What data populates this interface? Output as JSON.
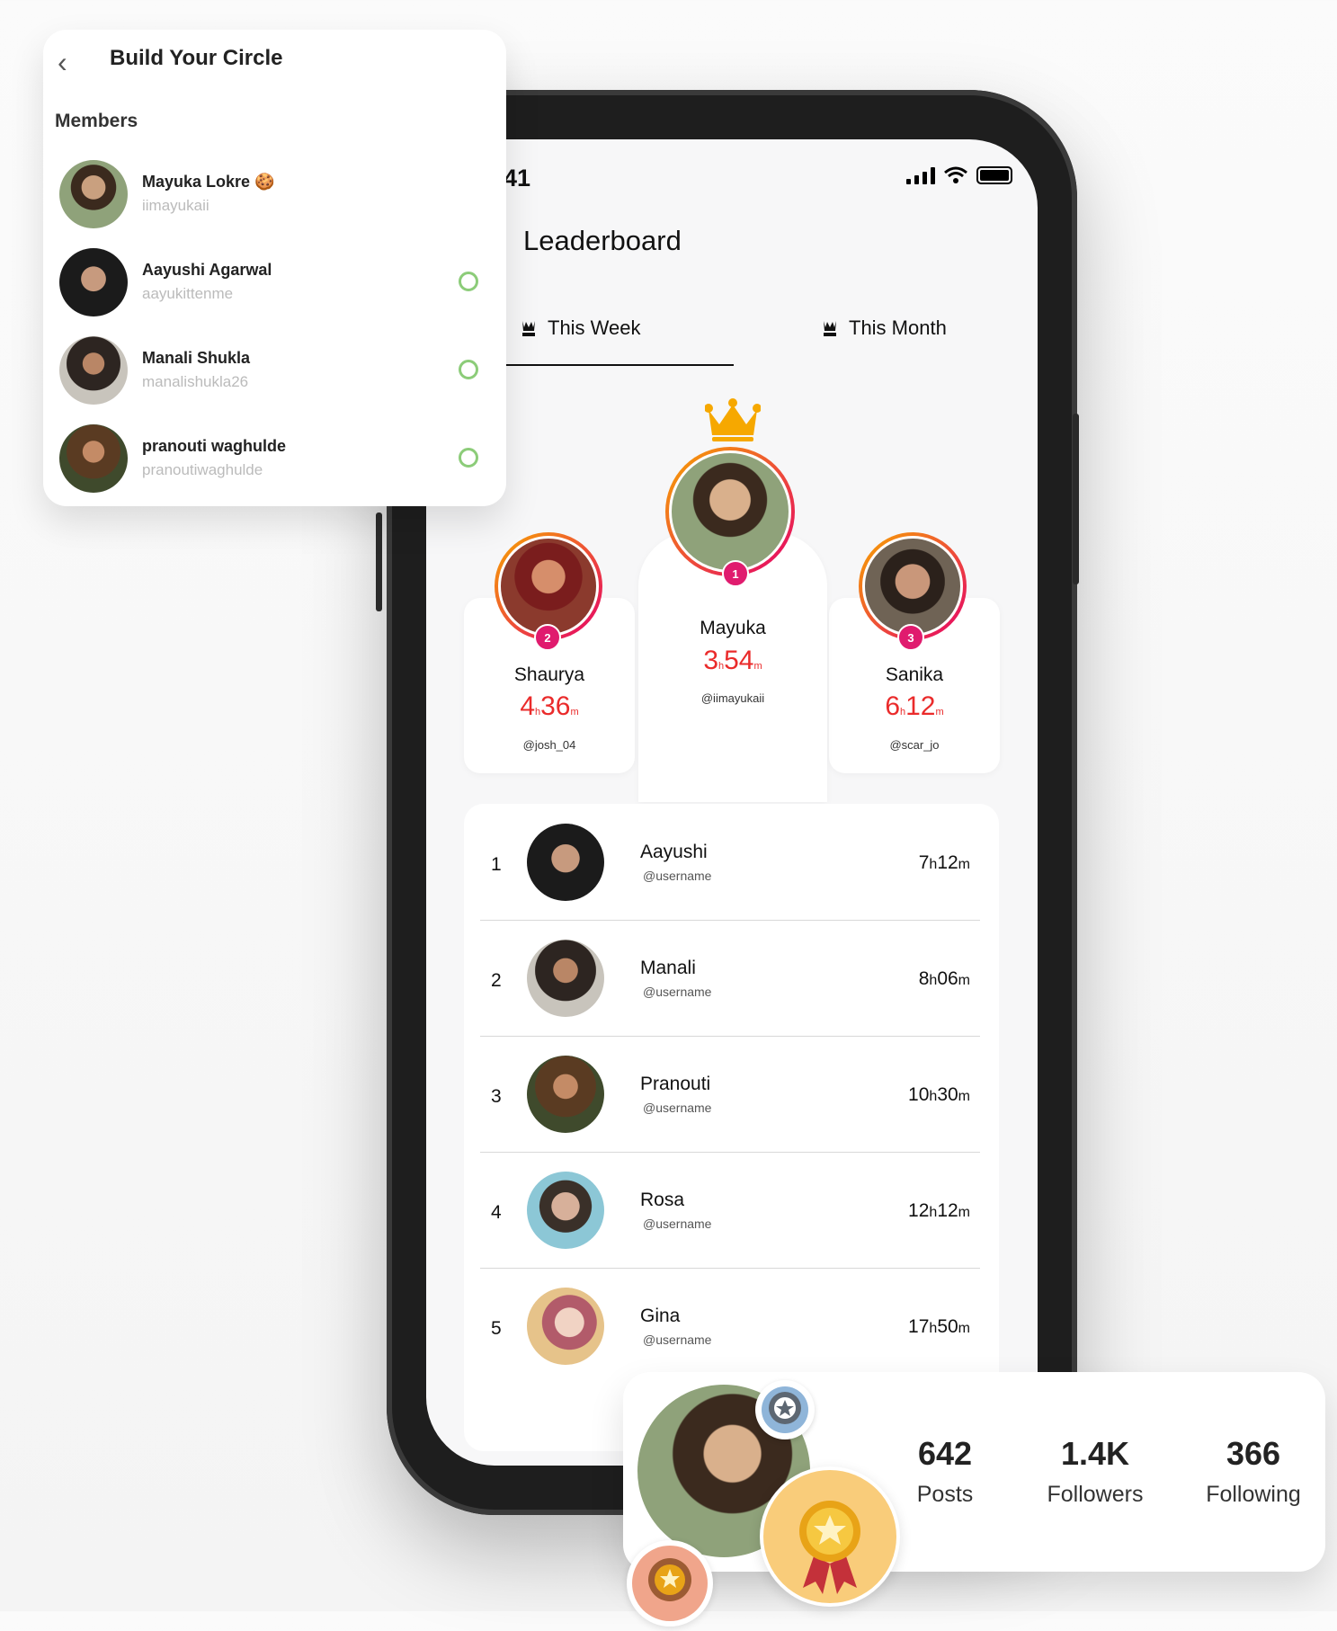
{
  "status": {
    "time": "41"
  },
  "screen": {
    "title": "Leaderboard"
  },
  "tabs": [
    {
      "label": "This Week"
    },
    {
      "label": "This Month"
    }
  ],
  "podium": [
    {
      "rank": "1",
      "name": "Mayuka",
      "hours": "3",
      "minutes": "54",
      "handle": "@iimayukaii"
    },
    {
      "rank": "2",
      "name": "Shaurya",
      "hours": "4",
      "minutes": "36",
      "handle": "@josh_04"
    },
    {
      "rank": "3",
      "name": "Sanika",
      "hours": "6",
      "minutes": "12",
      "handle": "@scar_jo"
    }
  ],
  "time_units": {
    "h": "h",
    "m": "m"
  },
  "leaderboard": [
    {
      "rank": "1",
      "name": "Aayushi",
      "handle": "@username",
      "hours": "7",
      "minutes": "12"
    },
    {
      "rank": "2",
      "name": "Manali",
      "handle": "@username",
      "hours": "8",
      "minutes": "06"
    },
    {
      "rank": "3",
      "name": "Pranouti",
      "handle": "@username",
      "hours": "10",
      "minutes": "30"
    },
    {
      "rank": "4",
      "name": "Rosa",
      "handle": "@username",
      "hours": "12",
      "minutes": "12"
    },
    {
      "rank": "5",
      "name": "Gina",
      "handle": "@username",
      "hours": "17",
      "minutes": "50"
    }
  ],
  "circle": {
    "title": "Build Your Circle",
    "members_label": "Members",
    "members": [
      {
        "name": "Mayuka Lokre",
        "username": "iimayukaii",
        "emoji": "🍪"
      },
      {
        "name": "Aayushi Agarwal",
        "username": "aayukittenme"
      },
      {
        "name": "Manali Shukla",
        "username": "manalishukla26"
      },
      {
        "name": "pranouti waghulde",
        "username": "pranoutiwaghulde"
      }
    ]
  },
  "profile": {
    "stats": [
      {
        "value": "642",
        "label": "Posts"
      },
      {
        "value": "1.4K",
        "label": "Followers"
      },
      {
        "value": "366",
        "label": "Following"
      }
    ]
  },
  "colors": {
    "accent": "#e01b6e",
    "time_red": "#ea2b2b",
    "crown": "#f6a800",
    "check_green": "#6fbf57"
  }
}
